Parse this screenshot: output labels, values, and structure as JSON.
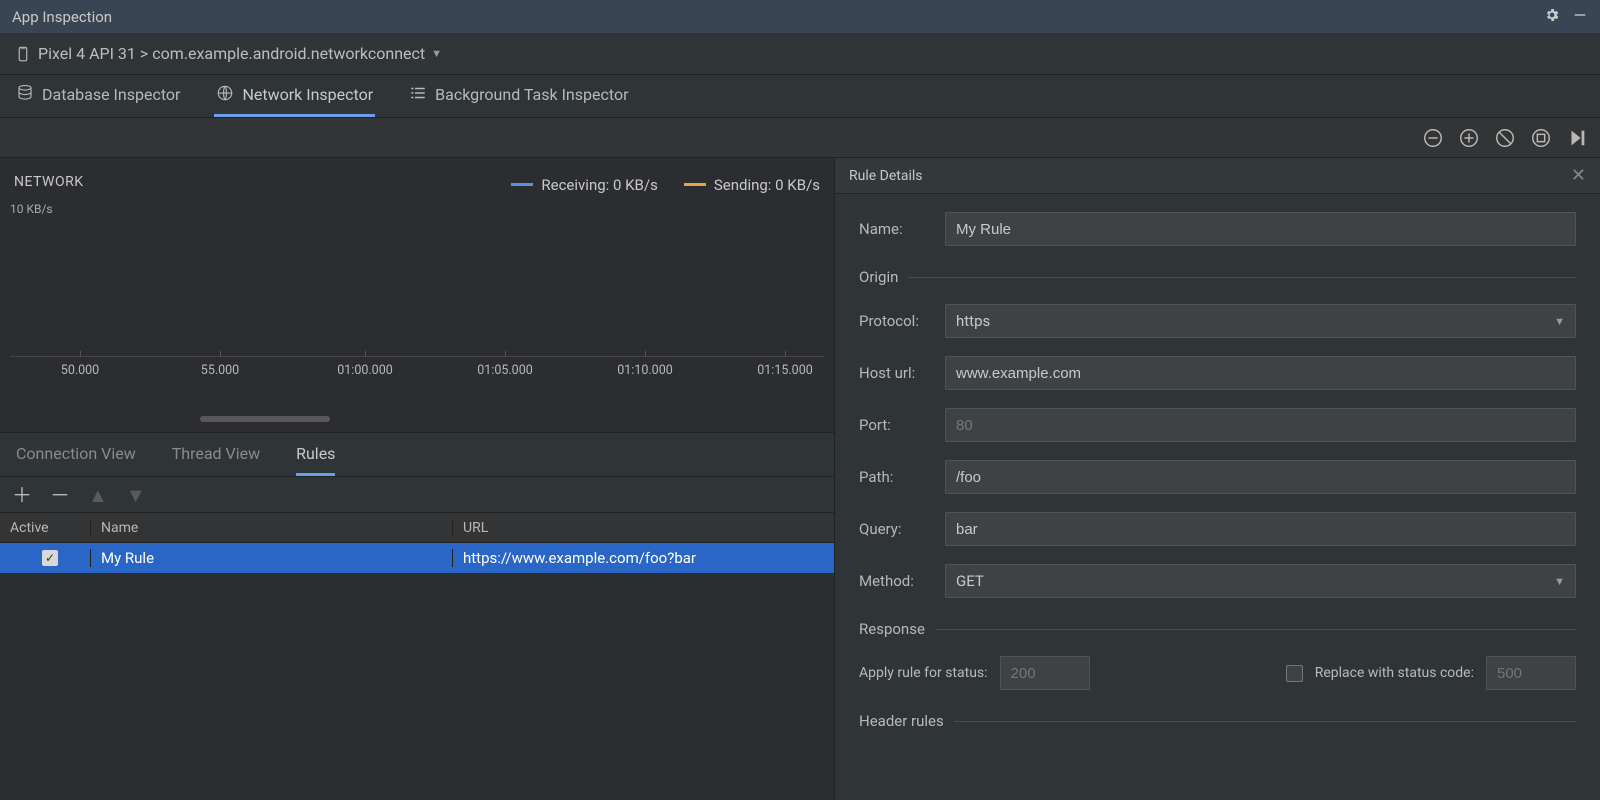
{
  "titlebar": {
    "title": "App Inspection"
  },
  "device": {
    "path": "Pixel 4 API 31 > com.example.android.networkconnect"
  },
  "tabs": {
    "database": "Database Inspector",
    "network": "Network Inspector",
    "background": "Background Task Inspector"
  },
  "chart": {
    "title": "NETWORK",
    "ylabel": "10 KB/s",
    "legend": {
      "receiving": "Receiving: 0 KB/s",
      "sending": "Sending: 0 KB/s"
    },
    "ticks": [
      "50.000",
      "55.000",
      "01:00.000",
      "01:05.000",
      "01:10.000",
      "01:15.000"
    ]
  },
  "chart_data": {
    "type": "line",
    "title": "NETWORK",
    "ylabel": "KB/s",
    "ylim": [
      0,
      10
    ],
    "x_unit": "mm:ss.SSS",
    "series": [
      {
        "name": "Receiving",
        "color": "#5e8fe6",
        "current": "0 KB/s",
        "values": []
      },
      {
        "name": "Sending",
        "color": "#e2a44a",
        "current": "0 KB/s",
        "values": []
      }
    ],
    "x_ticks": [
      "50.000",
      "55.000",
      "01:00.000",
      "01:05.000",
      "01:10.000",
      "01:15.000"
    ]
  },
  "subtabs": {
    "connection": "Connection View",
    "thread": "Thread View",
    "rules": "Rules"
  },
  "rules_table": {
    "headers": {
      "active": "Active",
      "name": "Name",
      "url": "URL"
    },
    "rows": [
      {
        "active": true,
        "name": "My Rule",
        "url": "https://www.example.com/foo?bar"
      }
    ]
  },
  "details": {
    "title": "Rule Details",
    "form": {
      "name_label": "Name:",
      "name_value": "My Rule",
      "origin_section": "Origin",
      "protocol_label": "Protocol:",
      "protocol_value": "https",
      "hosturl_label": "Host url:",
      "hosturl_value": "www.example.com",
      "port_label": "Port:",
      "port_placeholder": "80",
      "path_label": "Path:",
      "path_value": "/foo",
      "query_label": "Query:",
      "query_value": "bar",
      "method_label": "Method:",
      "method_value": "GET",
      "response_section": "Response",
      "apply_status_label": "Apply rule for status:",
      "apply_status_placeholder": "200",
      "replace_status_label": "Replace with status code:",
      "replace_status_placeholder": "500",
      "header_rules_section": "Header rules"
    }
  },
  "colors": {
    "receiving": "#5e8fe6",
    "sending": "#e2a44a"
  }
}
